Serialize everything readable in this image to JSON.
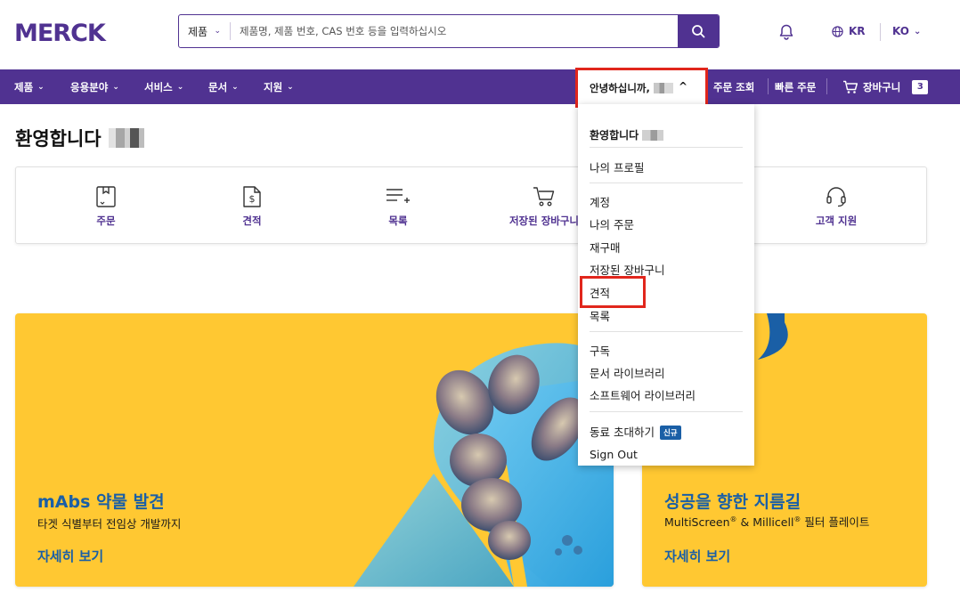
{
  "header": {
    "logo_text": "MERCK",
    "search": {
      "category": "제품",
      "placeholder": "제품명, 제품 번호, CAS 번호 등을 입력하십시오"
    },
    "region": "KR",
    "language": "KO"
  },
  "nav": {
    "items": [
      {
        "label": "제품"
      },
      {
        "label": "응용분야"
      },
      {
        "label": "서비스"
      },
      {
        "label": "문서"
      },
      {
        "label": "지원"
      }
    ],
    "greeting": "안녕하십니까,",
    "order_lookup": "주문 조회",
    "quick_order": "빠른 주문",
    "cart": "장바구니",
    "cart_count": "3"
  },
  "page": {
    "welcome": "환영합니다"
  },
  "quick_links": [
    {
      "label": "주문",
      "icon": "order-box-icon"
    },
    {
      "label": "견적",
      "icon": "quote-dollar-icon"
    },
    {
      "label": "목록",
      "icon": "list-add-icon"
    },
    {
      "label": "저장된 장바구니",
      "icon": "cart-icon"
    },
    {
      "label": "고객 지원",
      "icon": "headset-icon"
    }
  ],
  "banners": {
    "left": {
      "title": "mAbs 약물 발견",
      "subtitle": "타겟 식별부터 전임상 개발까지",
      "link": "자세히 보기"
    },
    "right": {
      "title": "성공을 향한 지름길",
      "subtitle_a": "MultiScreen",
      "subtitle_b": " & Millicell",
      "subtitle_c": " 필터 플레이트",
      "reg": "®",
      "link": "자세히 보기"
    }
  },
  "dropdown": {
    "heading": "환영합니다",
    "items": {
      "profile": "나의 프로필",
      "account": "계정",
      "my_orders": "나의 주문",
      "reorder": "재구매",
      "saved_carts": "저장된 장바구니",
      "quotes": "견적",
      "lists": "목록",
      "subscriptions": "구독",
      "document_library": "문서 라이브러리",
      "software_library": "소프트웨어 라이브러리",
      "invite": "동료 초대하기",
      "new_badge": "신규",
      "sign_out": "Sign Out"
    }
  },
  "colors": {
    "brand_purple": "#503291",
    "banner_yellow": "#ffc832",
    "link_blue": "#1a5fa6",
    "highlight_red": "#e1261c"
  }
}
